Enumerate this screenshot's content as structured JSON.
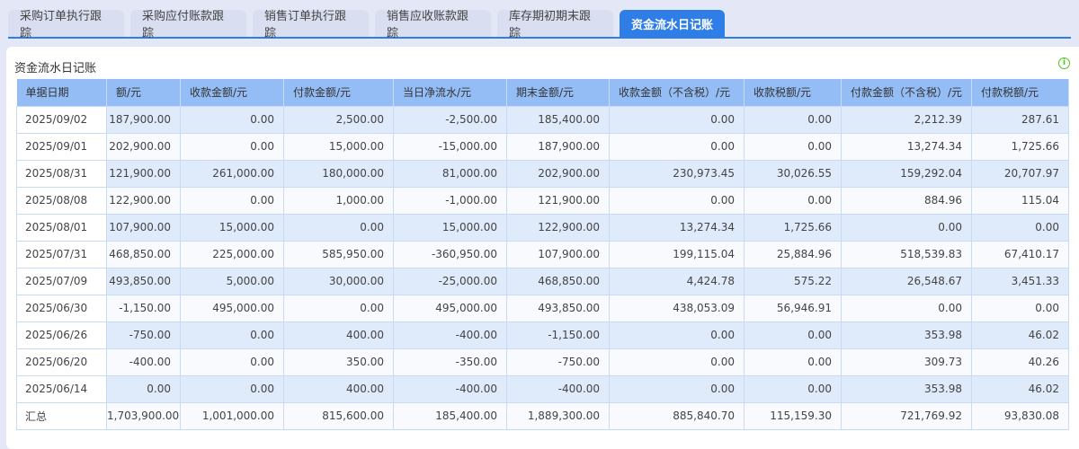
{
  "tabs": [
    "采购订单执行跟踪",
    "采购应付账款跟踪",
    "销售订单执行跟踪",
    "销售应收账款跟踪",
    "库存期初期末跟踪",
    "资金流水日记账"
  ],
  "active_tab": 5,
  "panel_title": "资金流水日记账",
  "info_icon": "i",
  "columns": [
    "单据日期",
    "额/元",
    "收款金额/元",
    "付款金额/元",
    "当日净流水/元",
    "期末金额/元",
    "收款金额（不含税）/元",
    "收款税额/元",
    "付款金额（不含税）/元",
    "付款税额/元"
  ],
  "rows": [
    [
      "2025/09/02",
      "187,900.00",
      "0.00",
      "2,500.00",
      "-2,500.00",
      "185,400.00",
      "0.00",
      "0.00",
      "2,212.39",
      "287.61"
    ],
    [
      "2025/09/01",
      "202,900.00",
      "0.00",
      "15,000.00",
      "-15,000.00",
      "187,900.00",
      "0.00",
      "0.00",
      "13,274.34",
      "1,725.66"
    ],
    [
      "2025/08/31",
      "121,900.00",
      "261,000.00",
      "180,000.00",
      "81,000.00",
      "202,900.00",
      "230,973.45",
      "30,026.55",
      "159,292.04",
      "20,707.97"
    ],
    [
      "2025/08/08",
      "122,900.00",
      "0.00",
      "1,000.00",
      "-1,000.00",
      "121,900.00",
      "0.00",
      "0.00",
      "884.96",
      "115.04"
    ],
    [
      "2025/08/01",
      "107,900.00",
      "15,000.00",
      "0.00",
      "15,000.00",
      "122,900.00",
      "13,274.34",
      "1,725.66",
      "0.00",
      "0.00"
    ],
    [
      "2025/07/31",
      "468,850.00",
      "225,000.00",
      "585,950.00",
      "-360,950.00",
      "107,900.00",
      "199,115.04",
      "25,884.96",
      "518,539.83",
      "67,410.17"
    ],
    [
      "2025/07/09",
      "493,850.00",
      "5,000.00",
      "30,000.00",
      "-25,000.00",
      "468,850.00",
      "4,424.78",
      "575.22",
      "26,548.67",
      "3,451.33"
    ],
    [
      "2025/06/30",
      "-1,150.00",
      "495,000.00",
      "0.00",
      "495,000.00",
      "493,850.00",
      "438,053.09",
      "56,946.91",
      "0.00",
      "0.00"
    ],
    [
      "2025/06/26",
      "-750.00",
      "0.00",
      "400.00",
      "-400.00",
      "-1,150.00",
      "0.00",
      "0.00",
      "353.98",
      "46.02"
    ],
    [
      "2025/06/20",
      "-400.00",
      "0.00",
      "350.00",
      "-350.00",
      "-750.00",
      "0.00",
      "0.00",
      "309.73",
      "40.26"
    ],
    [
      "2025/06/14",
      "0.00",
      "0.00",
      "400.00",
      "-400.00",
      "-400.00",
      "0.00",
      "0.00",
      "353.98",
      "46.02"
    ],
    [
      "汇总",
      "1,703,900.00",
      "1,001,000.00",
      "815,600.00",
      "185,400.00",
      "1,889,300.00",
      "885,840.70",
      "115,159.30",
      "721,769.92",
      "93,830.08"
    ]
  ]
}
